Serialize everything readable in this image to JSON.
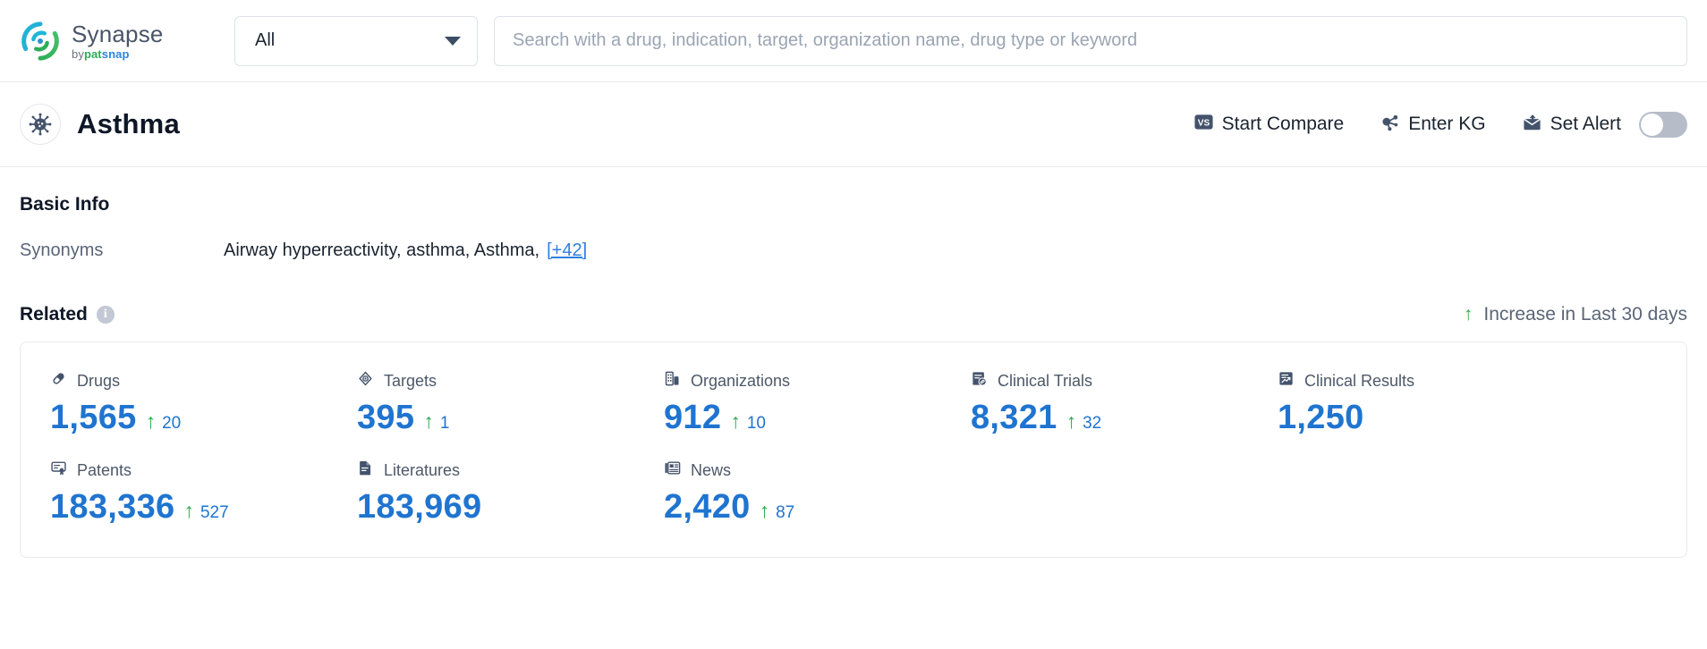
{
  "brand": {
    "name": "Synapse",
    "by": "by",
    "pat": "pat",
    "snap": "snap",
    "logo_icon": "synapse-swirl-logo"
  },
  "search": {
    "scope_value": "All",
    "scope_caret_icon": "chevron-down-icon",
    "placeholder": "Search with a drug, indication, target, organization name, drug type or keyword",
    "value": ""
  },
  "entity": {
    "title": "Asthma",
    "avatar_icon": "virus-icon",
    "actions": [
      {
        "label": "Start Compare",
        "icon": "vs-compare-icon"
      },
      {
        "label": "Enter KG",
        "icon": "knowledge-graph-icon"
      },
      {
        "label": "Set Alert",
        "icon": "alert-mail-icon",
        "toggle": "off"
      }
    ]
  },
  "basic_info": {
    "title": "Basic Info",
    "synonyms_label": "Synonyms",
    "synonyms_value": "Airway hyperreactivity,  asthma,  Asthma,",
    "synonyms_more": "[+42]"
  },
  "related": {
    "title": "Related",
    "info_icon": "info-icon",
    "info_glyph": "i",
    "legend_arrow": "↑",
    "legend_label": "Increase in Last 30 days",
    "metrics": [
      {
        "name": "Drugs",
        "icon": "pill-icon",
        "value": "1,565",
        "delta": "20"
      },
      {
        "name": "Targets",
        "icon": "target-icon",
        "value": "395",
        "delta": "1"
      },
      {
        "name": "Organizations",
        "icon": "building-icon",
        "value": "912",
        "delta": "10"
      },
      {
        "name": "Clinical Trials",
        "icon": "clinical-trial-icon",
        "value": "8,321",
        "delta": "32"
      },
      {
        "name": "Clinical Results",
        "icon": "clinical-results-icon",
        "value": "1,250",
        "delta": ""
      },
      {
        "name": "Patents",
        "icon": "patent-icon",
        "value": "183,336",
        "delta": "527"
      },
      {
        "name": "Literatures",
        "icon": "literature-icon",
        "value": "183,969",
        "delta": ""
      },
      {
        "name": "News",
        "icon": "news-icon",
        "value": "2,420",
        "delta": "87"
      }
    ]
  },
  "colors": {
    "accent_blue": "#1f74d0",
    "link_blue": "#2f7fe0",
    "increase_green": "#2bab4f",
    "icon_slate": "#44536b",
    "border": "#e7eaee"
  }
}
